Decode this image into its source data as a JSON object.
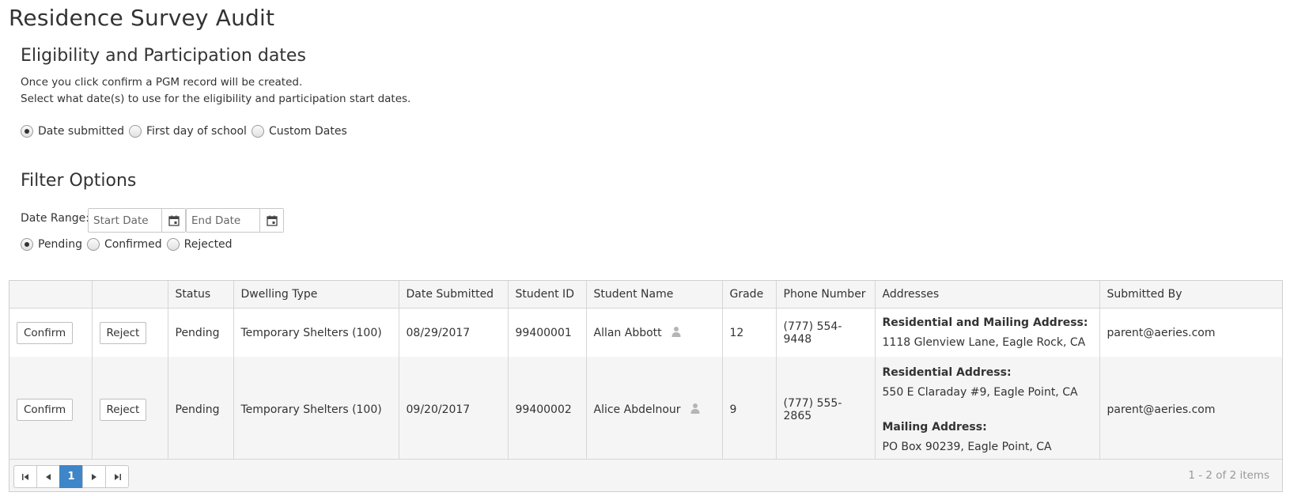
{
  "page_title": "Residence Survey Audit",
  "eligibility": {
    "title": "Eligibility and Participation dates",
    "line1": "Once you click confirm a PGM record will be created.",
    "line2": "Select what date(s) to use for the eligibility and participation start dates.",
    "options": [
      {
        "label": "Date submitted",
        "checked": true
      },
      {
        "label": "First day of school",
        "checked": false
      },
      {
        "label": "Custom Dates",
        "checked": false
      }
    ]
  },
  "filter": {
    "title": "Filter Options",
    "date_range_label": "Date Range:",
    "start_placeholder": "Start Date",
    "end_placeholder": "End Date",
    "status_options": [
      {
        "label": "Pending",
        "checked": true
      },
      {
        "label": "Confirmed",
        "checked": false
      },
      {
        "label": "Rejected",
        "checked": false
      }
    ]
  },
  "grid": {
    "columns": [
      "",
      "",
      "Status",
      "Dwelling Type",
      "Date Submitted",
      "Student ID",
      "Student Name",
      "Grade",
      "Phone Number",
      "Addresses",
      "Submitted By"
    ],
    "confirm_label": "Confirm",
    "reject_label": "Reject",
    "rows": [
      {
        "status": "Pending",
        "dwelling": "Temporary Shelters (100)",
        "date": "08/29/2017",
        "student_id": "99400001",
        "name": "Allan Abbott",
        "grade": "12",
        "phone": "(777) 554-9448",
        "addr1_head": "Residential and Mailing Address:",
        "addr1_line": "1118 Glenview Lane, Eagle Rock, CA",
        "submitted_by": "parent@aeries.com"
      },
      {
        "status": "Pending",
        "dwelling": "Temporary Shelters (100)",
        "date": "09/20/2017",
        "student_id": "99400002",
        "name": "Alice Abdelnour",
        "grade": "9",
        "phone": "(777) 555-2865",
        "addr1_head": "Residential Address:",
        "addr1_line": "550 E Claraday #9, Eagle Point, CA",
        "addr2_head": "Mailing Address:",
        "addr2_line": "PO Box 90239, Eagle Point, CA",
        "submitted_by": "parent@aeries.com"
      }
    ],
    "pager": {
      "current_page": "1",
      "info": "1 - 2 of 2 items"
    }
  }
}
